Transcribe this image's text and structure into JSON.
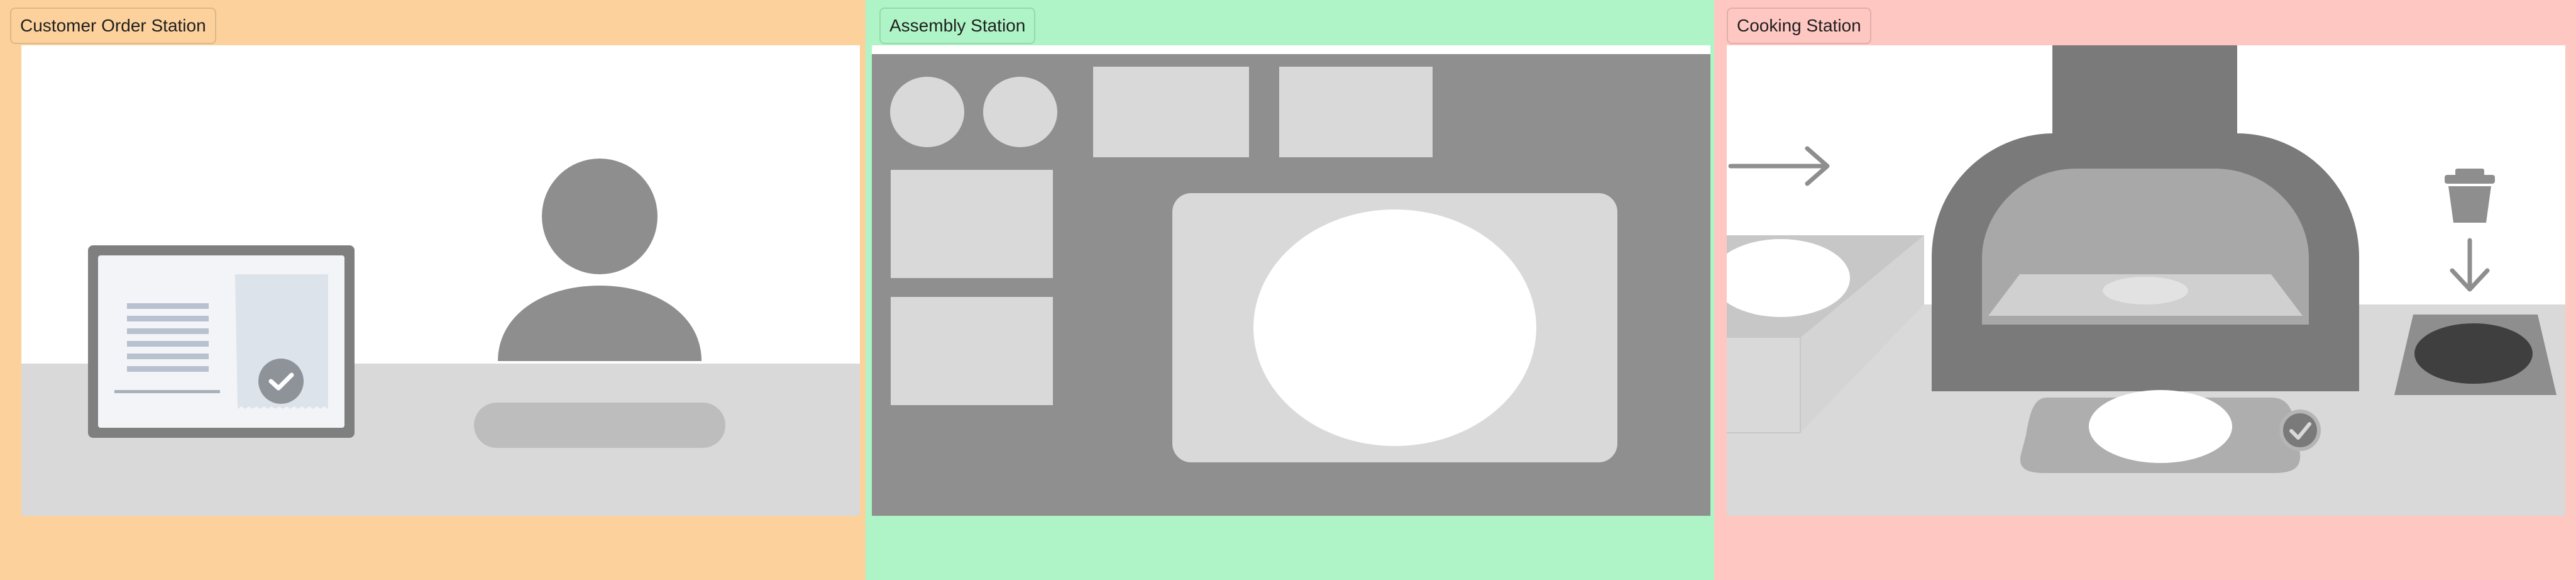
{
  "stations": [
    {
      "label": "Customer Order Station",
      "bg": "#fcd19c"
    },
    {
      "label": "Assembly Station",
      "bg": "#aff4c6"
    },
    {
      "label": "Cooking Station",
      "bg": "#ffc7c2"
    }
  ],
  "icons": {
    "order_confirmed": "check-icon",
    "trash": "trash-can-icon",
    "incoming": "arrow-right-icon",
    "drop": "arrow-down-icon",
    "cooked": "check-icon"
  }
}
